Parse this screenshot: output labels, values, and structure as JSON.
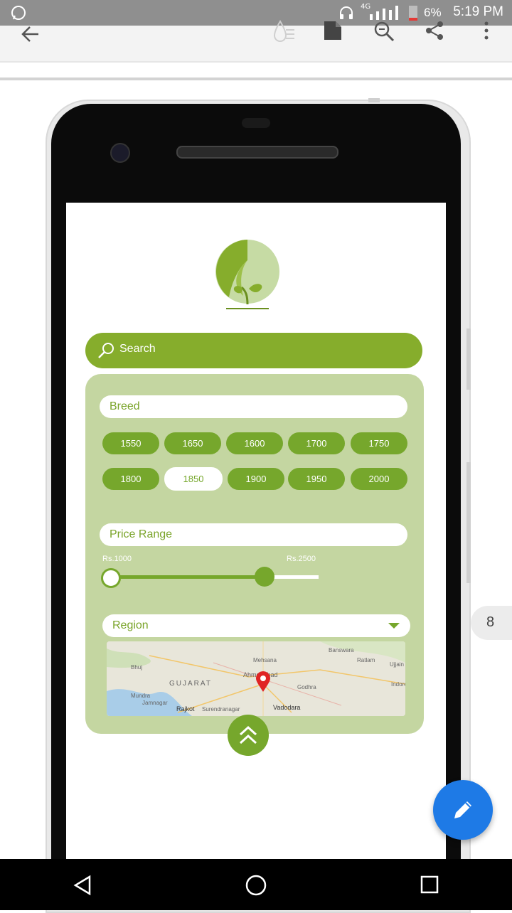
{
  "status_bar": {
    "battery": "6%",
    "time": "5:19 PM",
    "network": "4G"
  },
  "toolbar": {
    "icons": [
      "back-arrow-icon",
      "water-drop-icon",
      "file-icon",
      "zoom-icon",
      "share-icon",
      "more-vert-icon"
    ]
  },
  "app": {
    "search": {
      "label": "Search"
    },
    "breed": {
      "label": "Breed",
      "options": [
        "1550",
        "1650",
        "1600",
        "1700",
        "1750",
        "1800",
        "1850",
        "1900",
        "1950",
        "2000"
      ],
      "selected": "1850"
    },
    "price_range": {
      "label": "Price Range",
      "min_label": "Rs.1000",
      "max_label": "Rs.2500",
      "filled_fraction": 0.72
    },
    "region": {
      "label": "Region"
    },
    "map": {
      "labels": [
        "GUJARAT",
        "Ahmedabad",
        "Rajkot",
        "Surendranagar",
        "Vadodara",
        "Bhuj",
        "Mehsana",
        "Banswara",
        "Ratlam",
        "Ujjain",
        "Indore",
        "Godhra",
        "Jamnagar",
        "Mundra"
      ]
    }
  },
  "page_indicator": "8",
  "colors": {
    "primary_green": "#86ad2c",
    "panel_green": "#c4d6a1",
    "fab_blue": "#1e7ae6"
  }
}
